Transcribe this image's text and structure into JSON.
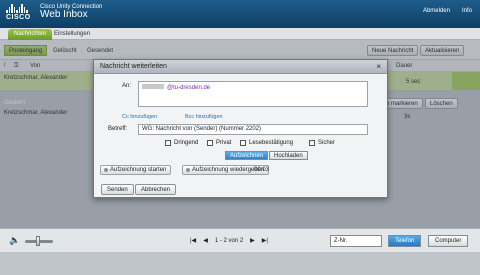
{
  "brand": {
    "logo_text": "CISCO",
    "title_line1": "Cisco Unity Connection",
    "title_line2": "Web Inbox"
  },
  "top_links": {
    "help_user": "      ",
    "signout": "Abmelden",
    "info": "Info"
  },
  "tabs": {
    "messages": "Nachrichten",
    "settings": "Einstellungen"
  },
  "folders": {
    "inbox": "Posteingang",
    "deleted": "Gelöscht",
    "sent": "Gesendet"
  },
  "toolbar": {
    "new_message": "Neue Nachricht",
    "refresh": "Aktualisieren"
  },
  "list": {
    "col_from": "Von",
    "col_duration": "Dauer",
    "row1_from": "Kretzschmar, Alexander",
    "row1_duration": "5 sec",
    "row2_from": "Kretzschmar, Alexander",
    "row2_duration": "3s",
    "mark_label": "n markieren",
    "delete_label": "Löschen"
  },
  "status": {
    "pager": "1 - 2 von 2",
    "search_placeholder": "Z-Nr.",
    "phone": "Telefon",
    "computer": "Computer"
  },
  "dialog": {
    "title": "Nachricht weiterleiten",
    "to_label": "An:",
    "to_value": "@tu-dresden.de",
    "cc_link": "Cc hinzufügen",
    "bcc_link": "Bcc hinzufügen",
    "subject_label": "Betreff:",
    "subject_value": "WG: Nachricht von (Sender) (Nummer 2202)",
    "urgent": "Dringend",
    "private": "Privat",
    "receipt": "Lesebestätigung",
    "secure": "Sicher",
    "record_tab": "Aufzeichnen",
    "upload_tab": "Hochladen",
    "start_record": "Aufzeichnung starten",
    "play_record": "Aufzeichnung wiedergeben",
    "time": "00:03",
    "send": "Senden",
    "cancel": "Abbrechen",
    "close_glyph": "×"
  }
}
